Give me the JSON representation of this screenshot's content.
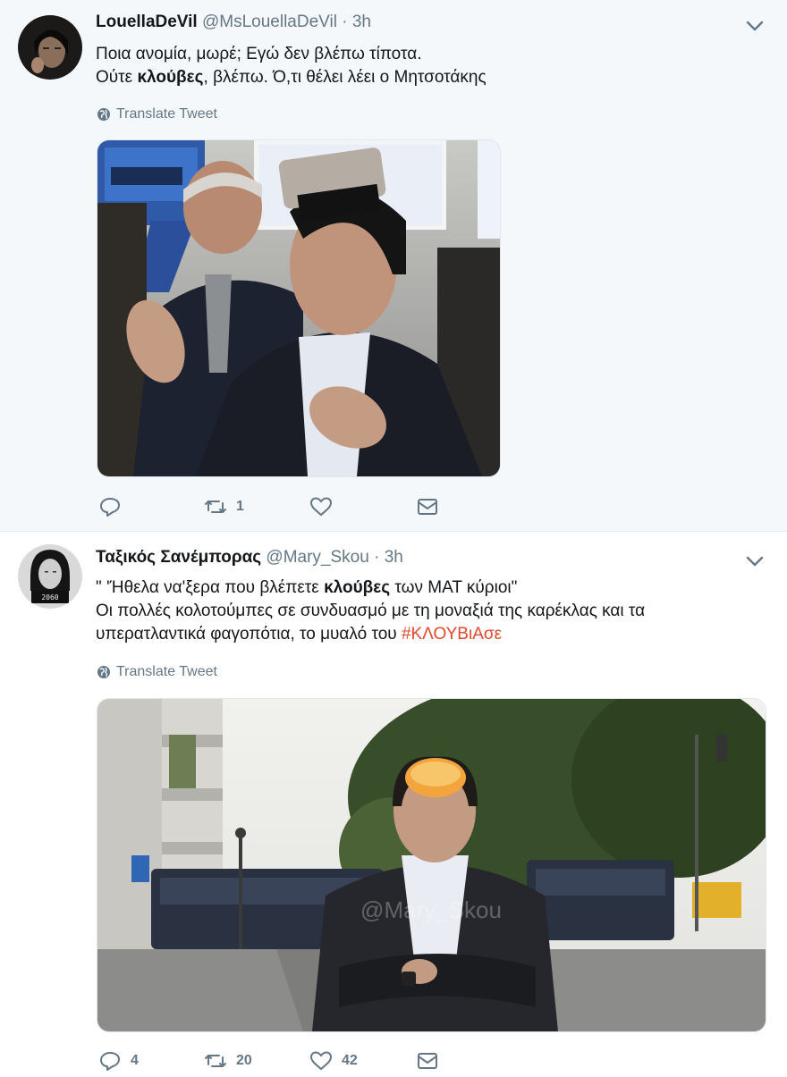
{
  "tweets": [
    {
      "name": "LouellaDeVil",
      "handle": "@MsLouellaDeVil",
      "dot": "·",
      "time": "3h",
      "lines": [
        [
          "Ποια ανομία, μωρέ; Εγώ δεν βλέπω τίποτα."
        ],
        [
          "Ούτε ",
          "κλούβες",
          ", βλέπω. Ό,τι θέλει λέει ο Μητσοτάκης"
        ]
      ],
      "translate": "Translate Tweet",
      "reply_count": "",
      "retweet_count": "1",
      "like_count": "",
      "media_watermark": ""
    },
    {
      "name": "Ταξικός Σανέμπορας",
      "handle": "@Mary_Skou",
      "dot": "·",
      "time": "3h",
      "line1_pre": "\" 'Ήθελα να'ξερα που βλέπετε ",
      "line1_bold": "κλούβες",
      "line1_post": " των ΜΑΤ κύριοι\"",
      "line2": "Οι πολλές κολοτούμπες σε συνδυασμό με τη μοναξιά της καρέκλας και τα",
      "line3_pre": "υπερατλαντικά φαγοπότια, το μυαλό του ",
      "hashtag": "#ΚΛΟΥΒιΑσε",
      "translate": "Translate Tweet",
      "reply_count": "4",
      "retweet_count": "20",
      "like_count": "42",
      "media_watermark": "@Mary_Skou"
    }
  ],
  "colors": {
    "name": "#14171a",
    "meta": "#657786",
    "hashtag": "#e0492c",
    "highlight_bg": "#f5f8fa"
  },
  "icons": [
    "chevron-down-icon",
    "globe-icon",
    "reply-icon",
    "retweet-icon",
    "like-icon",
    "dm-icon"
  ]
}
